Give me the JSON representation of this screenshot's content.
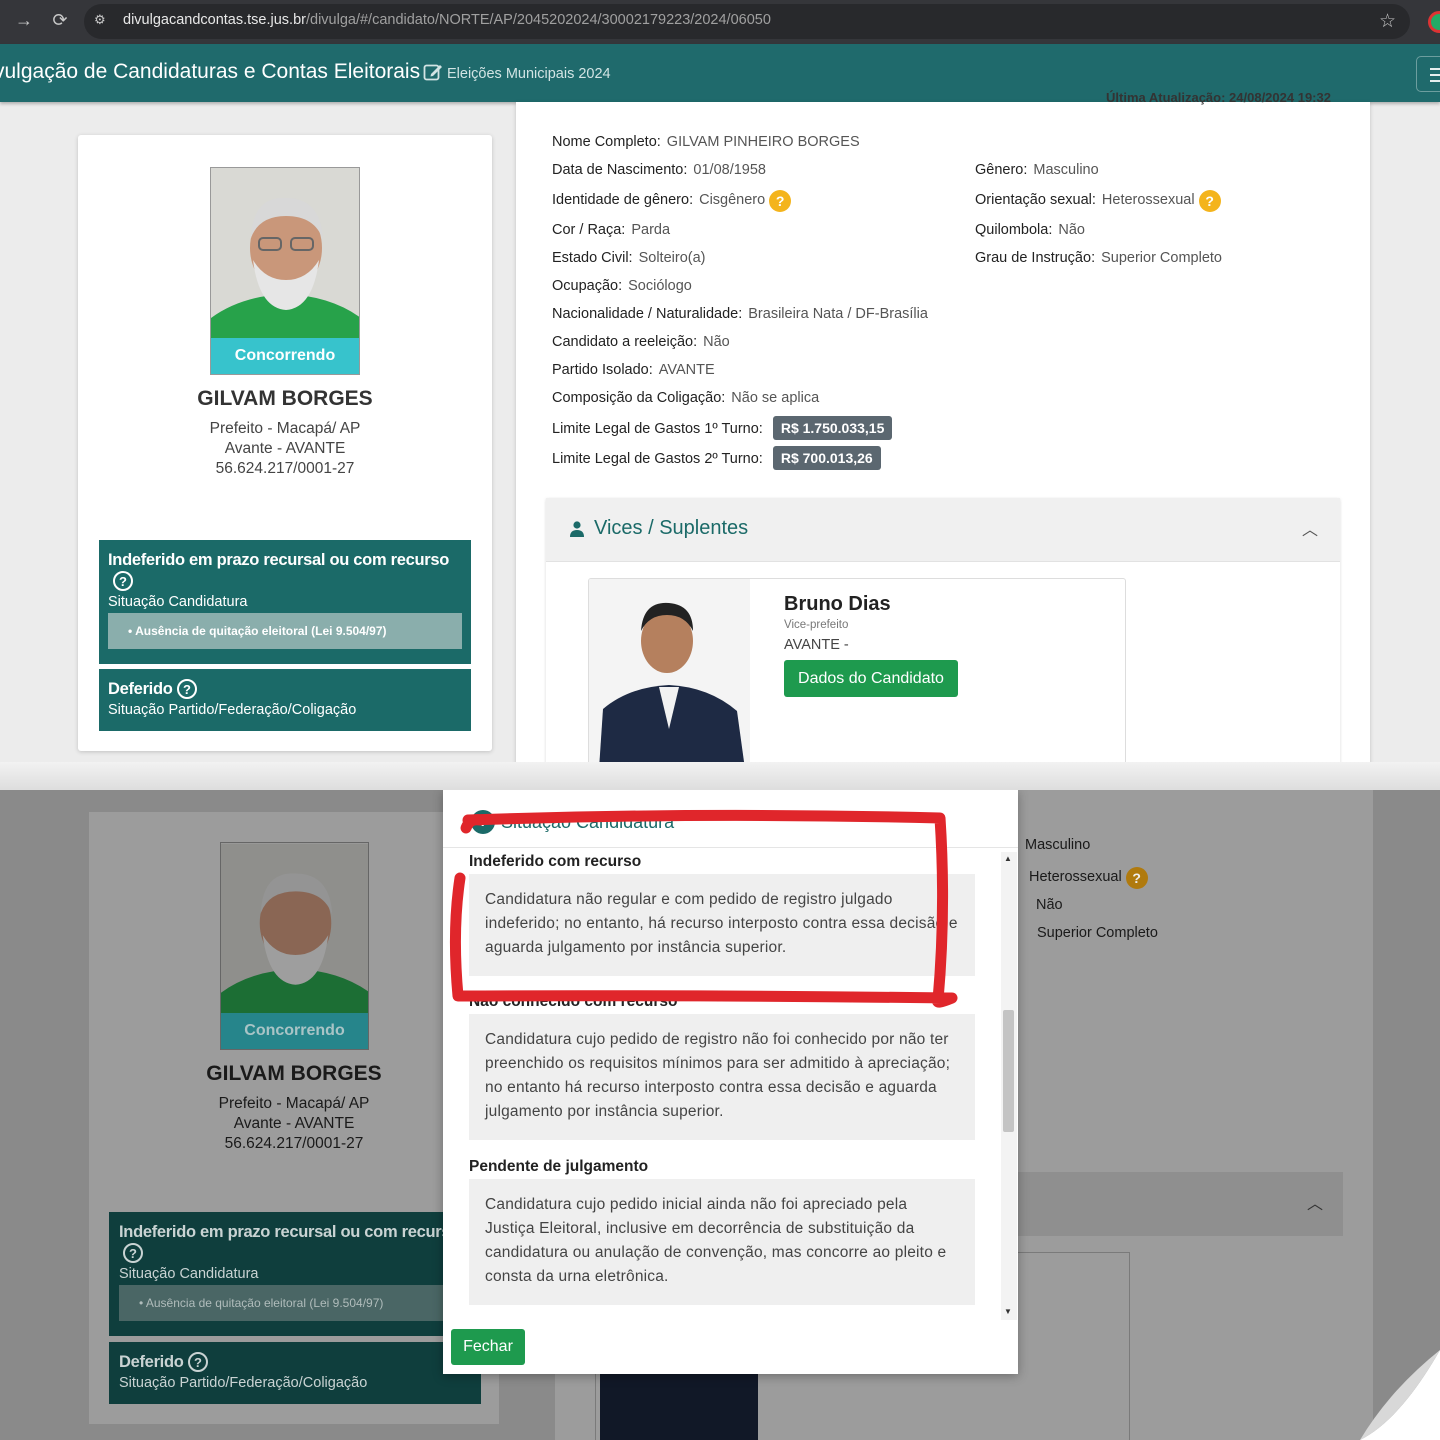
{
  "browser": {
    "url_host": "divulgacandcontas.tse.jus.br",
    "url_path": "/divulga/#/candidato/NORTE/AP/2045202024/30002179223/2024/06050"
  },
  "app": {
    "title": "vulgação de Candidaturas e Contas Eleitorais",
    "subtitle": "Eleições Municipais 2024",
    "clipped_header": "Última Atualização: 24/08/2024 19:32"
  },
  "candidate": {
    "badge": "Concorrendo",
    "name": "GILVAM BORGES",
    "line1": "Prefeito - Macapá/ AP",
    "line2": "Avante - AVANTE",
    "line3": "56.624.217/0001-27"
  },
  "status": {
    "candidatura_title": "Indeferido em prazo recursal ou com recurso",
    "candidatura_label": "Situação Candidatura",
    "candidatura_reason": "Ausência de quitação eleitoral (Lei 9.504/97)",
    "partido_title": "Deferido",
    "partido_label": "Situação Partido/Federação/Coligação",
    "help_glyph": "?"
  },
  "details": {
    "nome_label": "Nome Completo:",
    "nome": "GILVAM PINHEIRO BORGES",
    "nasc_label": "Data de Nascimento:",
    "nasc": "01/08/1958",
    "genero_label": "Gênero:",
    "genero": "Masculino",
    "ident_label": "Identidade de gênero:",
    "ident": "Cisgênero",
    "orient_label": "Orientação sexual:",
    "orient": "Heterossexual",
    "cor_label": "Cor / Raça:",
    "cor": "Parda",
    "quilombola_label": "Quilombola:",
    "quilombola": "Não",
    "civil_label": "Estado Civil:",
    "civil": "Solteiro(a)",
    "grau_label": "Grau de Instrução:",
    "grau": "Superior Completo",
    "ocup_label": "Ocupação:",
    "ocup": "Sociólogo",
    "nac_label": "Nacionalidade / Naturalidade:",
    "nac": "Brasileira Nata / DF-Brasília",
    "reel_label": "Candidato a reeleição:",
    "reel": "Não",
    "partido_label": "Partido Isolado:",
    "partido": "AVANTE",
    "comp_label": "Composição da Coligação:",
    "comp": "Não se aplica",
    "lim1_label": "Limite Legal de Gastos 1º Turno:",
    "lim1": "R$ 1.750.033,15",
    "lim2_label": "Limite Legal de Gastos 2º Turno:",
    "lim2": "R$ 700.013,26"
  },
  "vices": {
    "header": "Vices / Suplentes",
    "name": "Bruno Dias",
    "role": "Vice-prefeito",
    "party": "AVANTE -",
    "button": "Dados do Candidato"
  },
  "modal": {
    "title": "Situação Candidatura",
    "sections": [
      {
        "title": "Indeferido com recurso",
        "text": "Candidatura não regular e com pedido de registro julgado indeferido; no entanto, há recurso interposto contra essa decisão e aguarda julgamento por instância superior."
      },
      {
        "title": "Não conhecido com recurso",
        "text": "Candidatura cujo pedido de registro não foi conhecido por não ter preenchido os requisitos mínimos para ser admitido à apreciação; no entanto há recurso interposto contra essa decisão e aguarda julgamento por instância superior."
      },
      {
        "title": "Pendente de julgamento",
        "text": "Candidatura cujo pedido inicial ainda não foi apreciado pela Justiça Eleitoral, inclusive em decorrência de substituição da candidatura ou anulação de convenção, mas concorre ao pleito e consta da urna eletrônica."
      }
    ],
    "close": "Fechar"
  },
  "colors": {
    "teal": "#1b6a68",
    "green_button": "#1e9a4e",
    "badge": "#37c3cc",
    "help": "#f4b41c",
    "annotation": "#e0262b"
  }
}
